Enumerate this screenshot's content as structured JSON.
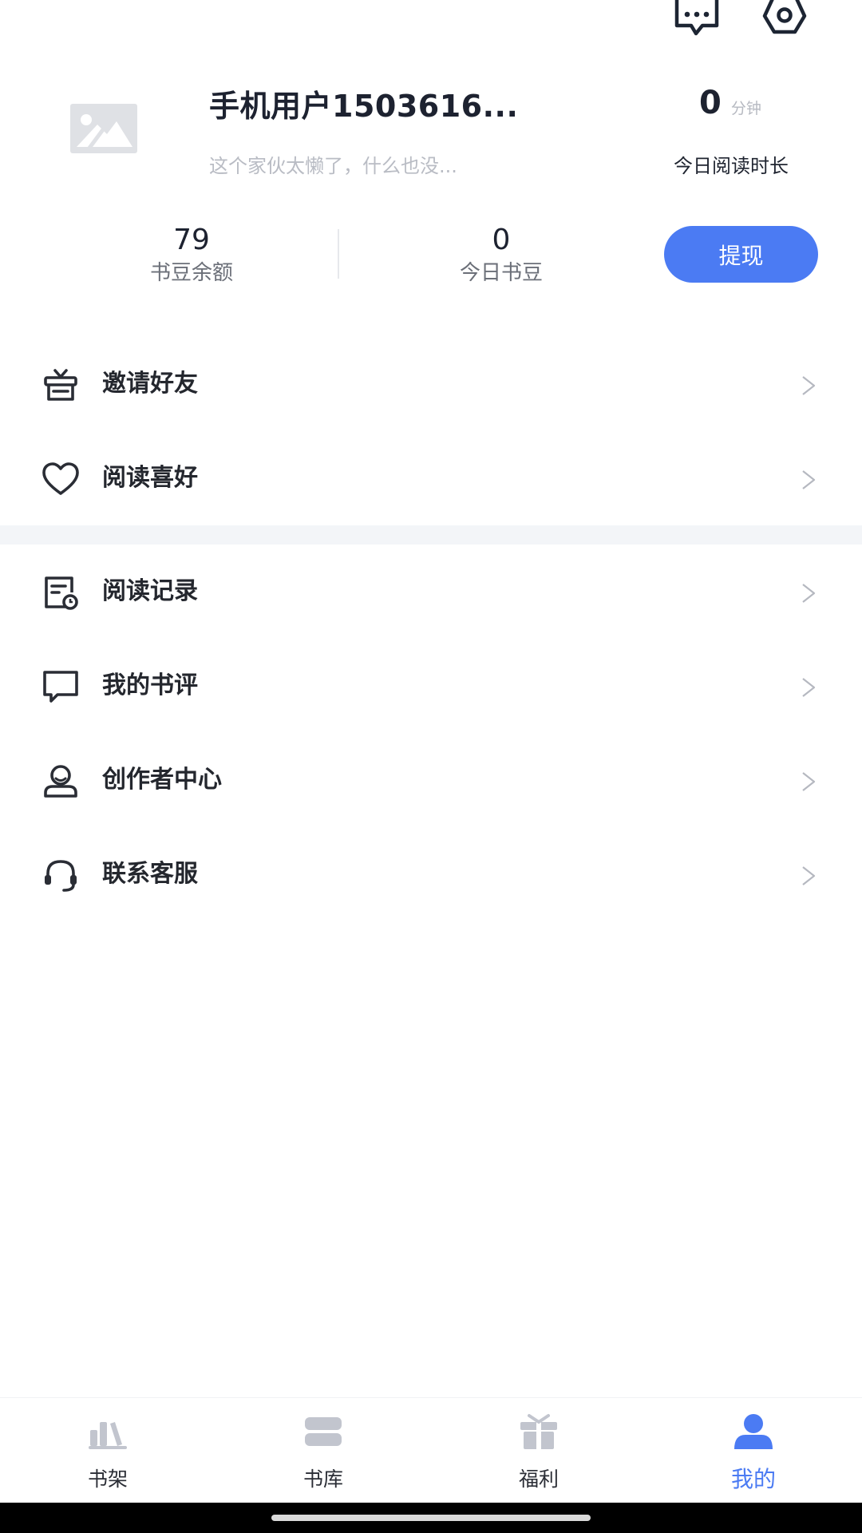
{
  "header_icons": {
    "messages": "chat-bubble-icon",
    "settings": "settings-hexagon-icon"
  },
  "profile": {
    "nickname": "手机用户1503616...",
    "signature": "这个家伙太懒了，什么也没...",
    "read_minutes": "0",
    "read_unit": "分钟",
    "read_label": "今日阅读时长"
  },
  "stats": {
    "balance_value": "79",
    "balance_label": "书豆余额",
    "today_value": "0",
    "today_label": "今日书豆",
    "withdraw_label": "提现"
  },
  "menu": [
    {
      "label": "邀请好友",
      "icon": "gift-icon"
    },
    {
      "label": "阅读喜好",
      "icon": "heart-icon"
    },
    {
      "label": "阅读记录",
      "icon": "reading-history-icon"
    },
    {
      "label": "我的书评",
      "icon": "comment-icon"
    },
    {
      "label": "创作者中心",
      "icon": "author-icon"
    },
    {
      "label": "联系客服",
      "icon": "headset-icon"
    }
  ],
  "menu_arrow": ">",
  "tabs": [
    {
      "label": "书架",
      "icon": "bookshelf-icon",
      "active": false
    },
    {
      "label": "书库",
      "icon": "library-icon",
      "active": false
    },
    {
      "label": "福利",
      "icon": "gift-icon",
      "active": false
    },
    {
      "label": "我的",
      "icon": "user-icon",
      "active": true
    }
  ],
  "colors": {
    "accent": "#4b7bf3",
    "text_primary": "#1d2230",
    "text_muted": "#b9bcc4",
    "tab_inactive_icon": "#c2c5ce",
    "section_gap": "#f3f5f8"
  }
}
